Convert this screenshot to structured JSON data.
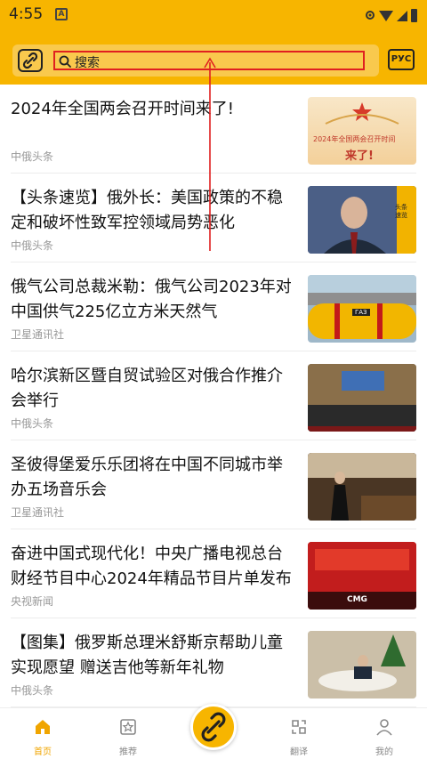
{
  "status_bar": {
    "time": "4:55",
    "notif_letter": "A"
  },
  "search": {
    "placeholder": "搜索"
  },
  "language_button": "РУС",
  "colors": {
    "brand": "#f7b500",
    "annotation": "#e02020"
  },
  "feed": [
    {
      "title": "2024年全国两会召开时间来了!",
      "source": "中俄头条",
      "thumb_caption": "2024年全国两会召开时间",
      "thumb_caption2": "来了!"
    },
    {
      "title": "【头条速览】俄外长：美国政策的不稳定和破坏性致军控领域局势恶化",
      "source": "中俄头条",
      "thumb_caption": "头条速览"
    },
    {
      "title": "俄气公司总裁米勒：俄气公司2023年对中国供气225亿立方米天然气",
      "source": "卫星通讯社",
      "thumb_caption": "ГАЗ"
    },
    {
      "title": "哈尔滨新区暨自贸试验区对俄合作推介会举行",
      "source": "中俄头条"
    },
    {
      "title": "圣彼得堡爱乐乐团将在中国不同城市举办五场音乐会",
      "source": "卫星通讯社"
    },
    {
      "title": "奋进中国式现代化！中央广播电视总台财经节目中心2024年精品节目片单发布",
      "source": "央视新闻",
      "thumb_caption": "CMG"
    },
    {
      "title": "【图集】俄罗斯总理米舒斯京帮助儿童实现愿望 赠送吉他等新年礼物",
      "source": "中俄头条"
    }
  ],
  "nav": [
    {
      "label": "首页",
      "icon": "home-icon",
      "active": true
    },
    {
      "label": "推荐",
      "icon": "star-box-icon",
      "active": false
    },
    {
      "label": "翻译",
      "icon": "translate-icon",
      "active": false
    },
    {
      "label": "我的",
      "icon": "person-icon",
      "active": false
    }
  ]
}
